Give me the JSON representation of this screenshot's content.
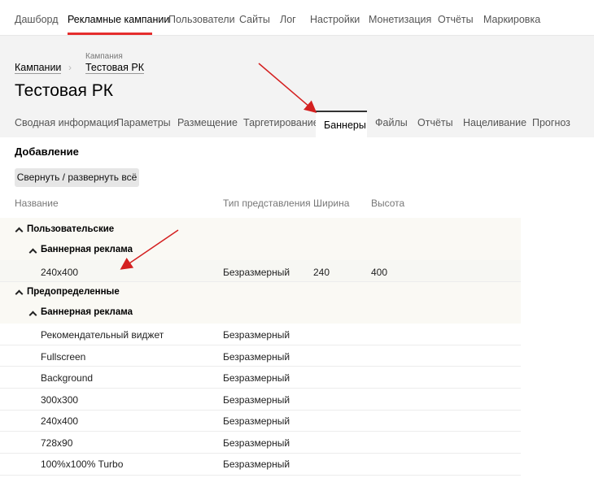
{
  "topnav": {
    "items": [
      "Дашборд",
      "Рекламные кампании",
      "Пользователи",
      "Сайты",
      "Лог",
      "Настройки",
      "Монетизация",
      "Отчёты",
      "Маркировка"
    ]
  },
  "breadcrumb": {
    "root": "Кампании",
    "small": "Кампания",
    "current": "Тестовая РК"
  },
  "page": {
    "title": "Тестовая РК"
  },
  "tabs": [
    "Сводная информация",
    "Параметры",
    "Размещение",
    "Таргетирование",
    "Баннеры",
    "Файлы",
    "Отчёты",
    "Нацеливание",
    "Прогноз"
  ],
  "section": {
    "title": "Добавление",
    "toggle_label": "Свернуть / развернуть всё"
  },
  "table": {
    "headers": [
      "Название",
      "Тип представления",
      "Ширина",
      "Высота"
    ],
    "groups": [
      {
        "title": "Пользовательские",
        "subtitle": "Баннерная реклама",
        "rows": [
          {
            "name": "240x400",
            "type": "Безразмерный",
            "width": "240",
            "height": "400"
          }
        ]
      },
      {
        "title": "Предопределенные",
        "subtitle": "Баннерная реклама",
        "rows": [
          {
            "name": "Рекомендательный виджет",
            "type": "Безразмерный",
            "width": "",
            "height": ""
          },
          {
            "name": "Fullscreen",
            "type": "Безразмерный",
            "width": "",
            "height": ""
          },
          {
            "name": "Background",
            "type": "Безразмерный",
            "width": "",
            "height": ""
          },
          {
            "name": "300x300",
            "type": "Безразмерный",
            "width": "",
            "height": ""
          },
          {
            "name": "240x400",
            "type": "Безразмерный",
            "width": "",
            "height": ""
          },
          {
            "name": "728x90",
            "type": "Безразмерный",
            "width": "",
            "height": ""
          },
          {
            "name": "100%x100% Turbo",
            "type": "Безразмерный",
            "width": "",
            "height": ""
          }
        ]
      }
    ]
  },
  "colors": {
    "accent": "#e52d2d",
    "annotation_arrow": "#d42020"
  }
}
